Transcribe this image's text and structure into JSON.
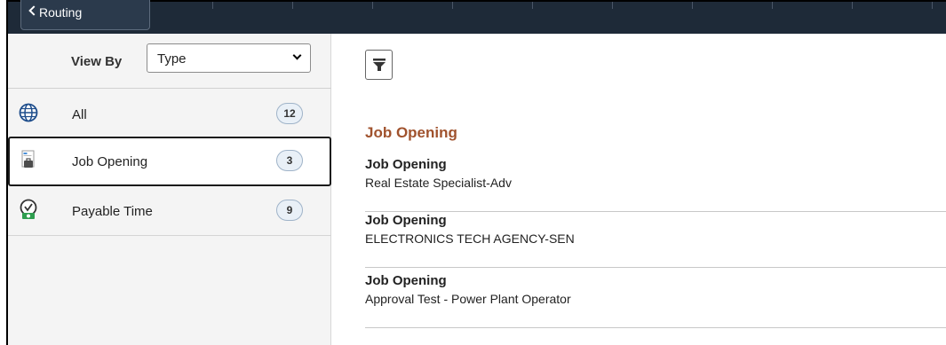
{
  "header": {
    "back_button_label": "Routing"
  },
  "view_by": {
    "label": "View By",
    "selected": "Type"
  },
  "categories": [
    {
      "label": "All",
      "count": "12",
      "icon": "globe-icon",
      "selected": false
    },
    {
      "label": "Job Opening",
      "count": "3",
      "icon": "job-opening-icon",
      "selected": true
    },
    {
      "label": "Payable Time",
      "count": "9",
      "icon": "clock-money-icon",
      "selected": false
    }
  ],
  "results": {
    "filter_icon": "filter-icon",
    "group_heading": "Job Opening",
    "items": [
      {
        "type": "Job Opening",
        "title": "Real Estate Specialist-Adv"
      },
      {
        "type": "Job Opening",
        "title": "ELECTRONICS TECH AGENCY-SEN"
      },
      {
        "type": "Job Opening",
        "title": "Approval Test - Power Plant Operator"
      }
    ]
  },
  "colors": {
    "header_bg": "#1e2a38",
    "group_heading": "#a0522d",
    "left_panel_bg": "#f4f4f4",
    "count_badge_bg": "#e9f0f7"
  }
}
